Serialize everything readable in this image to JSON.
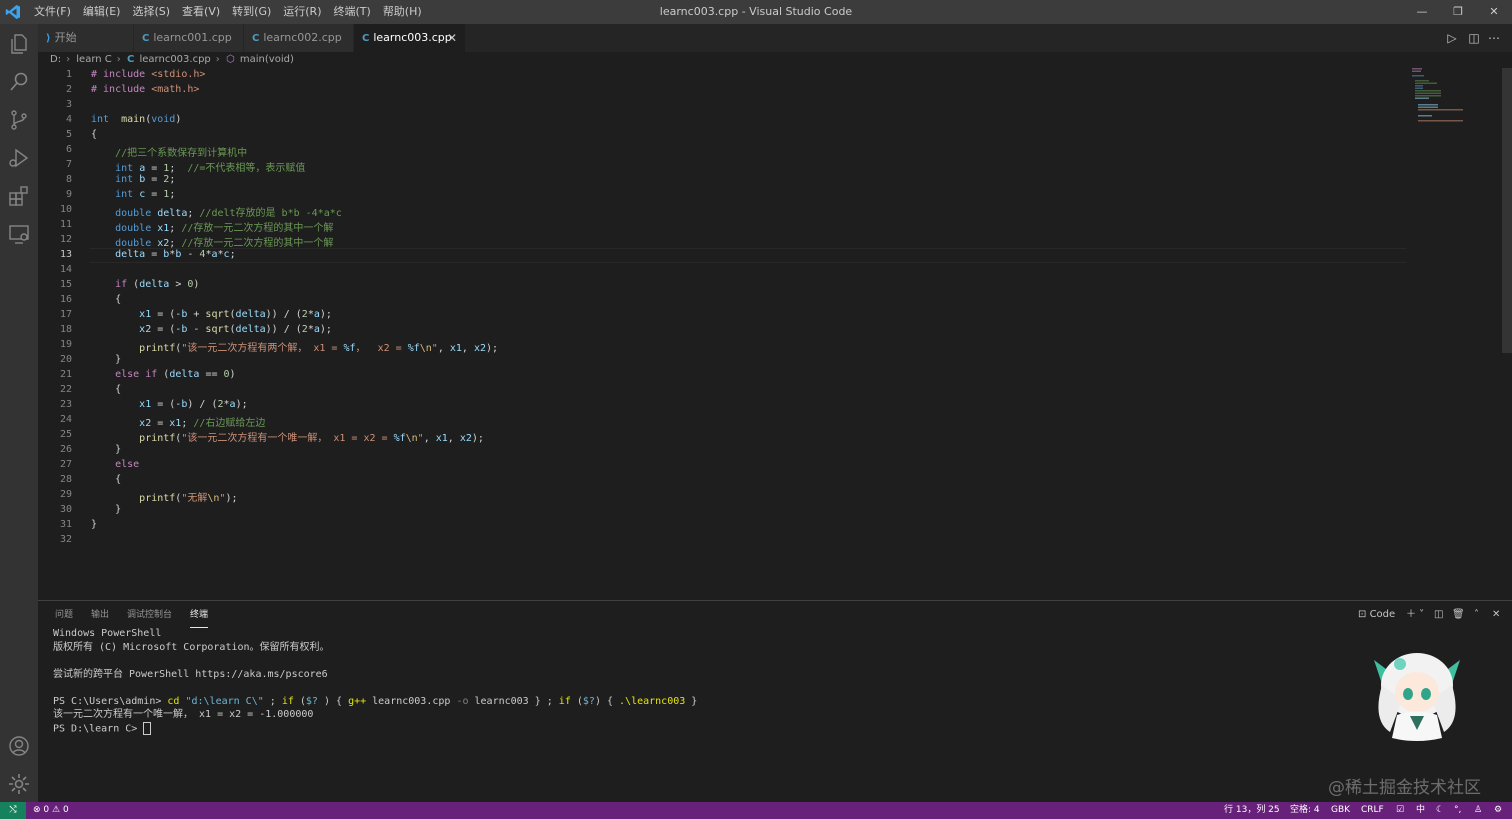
{
  "window": {
    "title": "learnc003.cpp - Visual Studio Code",
    "minimize": "—",
    "restore": "❐",
    "close": "✕"
  },
  "menu": [
    "文件(F)",
    "编辑(E)",
    "选择(S)",
    "查看(V)",
    "转到(G)",
    "运行(R)",
    "终端(T)",
    "帮助(H)"
  ],
  "activity_icons": [
    "files-icon",
    "search-icon",
    "source-control-icon",
    "run-debug-icon",
    "extensions-icon",
    "remote-explorer-icon",
    "account-icon",
    "settings-gear-icon"
  ],
  "tabs": [
    {
      "label": "开始",
      "icon": "vscode-icon",
      "active": false
    },
    {
      "label": "learnc001.cpp",
      "icon": "cpp-file-icon",
      "active": false
    },
    {
      "label": "learnc002.cpp",
      "icon": "cpp-file-icon",
      "active": false
    },
    {
      "label": "learnc003.cpp",
      "icon": "cpp-file-icon",
      "active": true
    }
  ],
  "breadcrumb": {
    "drive": "D:",
    "folder": "learn C",
    "file": "learnc003.cpp",
    "symbol": "main(void)"
  },
  "editor": {
    "current_line": 13,
    "line_numbers": [
      "1",
      "2",
      "3",
      "4",
      "5",
      "6",
      "7",
      "8",
      "9",
      "10",
      "11",
      "12",
      "13",
      "14",
      "15",
      "16",
      "17",
      "18",
      "19",
      "20",
      "21",
      "22",
      "23",
      "24",
      "25",
      "26",
      "27",
      "28",
      "29",
      "30",
      "31",
      "32"
    ],
    "lines": [
      [
        [
          "pp",
          "# include "
        ],
        [
          "str",
          "<stdio.h>"
        ]
      ],
      [
        [
          "pp",
          "# include "
        ],
        [
          "str",
          "<math.h>"
        ]
      ],
      [],
      [
        [
          "kw",
          "int"
        ],
        [
          "",
          "  "
        ],
        [
          "fn",
          "main"
        ],
        [
          "",
          "("
        ],
        [
          "kw",
          "void"
        ],
        [
          "",
          ")"
        ]
      ],
      [
        [
          "",
          "{"
        ]
      ],
      [
        [
          "",
          "    "
        ],
        [
          "cm",
          "//把三个系数保存到计算机中"
        ]
      ],
      [
        [
          "",
          "    "
        ],
        [
          "kw",
          "int"
        ],
        [
          "",
          " "
        ],
        [
          "var",
          "a"
        ],
        [
          "",
          " = "
        ],
        [
          "num",
          "1"
        ],
        [
          "",
          ";  "
        ],
        [
          "cm",
          "//=不代表相等，表示赋值"
        ]
      ],
      [
        [
          "",
          "    "
        ],
        [
          "kw",
          "int"
        ],
        [
          "",
          " "
        ],
        [
          "var",
          "b"
        ],
        [
          "",
          " = "
        ],
        [
          "num",
          "2"
        ],
        [
          "",
          ";"
        ]
      ],
      [
        [
          "",
          "    "
        ],
        [
          "kw",
          "int"
        ],
        [
          "",
          " "
        ],
        [
          "var",
          "c"
        ],
        [
          "",
          " = "
        ],
        [
          "num",
          "1"
        ],
        [
          "",
          ";"
        ]
      ],
      [
        [
          "",
          "    "
        ],
        [
          "kw",
          "double"
        ],
        [
          "",
          " "
        ],
        [
          "var",
          "delta"
        ],
        [
          "",
          "; "
        ],
        [
          "cm",
          "//delt存放的是 b*b -4*a*c"
        ]
      ],
      [
        [
          "",
          "    "
        ],
        [
          "kw",
          "double"
        ],
        [
          "",
          " "
        ],
        [
          "var",
          "x1"
        ],
        [
          "",
          "; "
        ],
        [
          "cm",
          "//存放一元二次方程的其中一个解"
        ]
      ],
      [
        [
          "",
          "    "
        ],
        [
          "kw",
          "double"
        ],
        [
          "",
          " "
        ],
        [
          "var",
          "x2"
        ],
        [
          "",
          "; "
        ],
        [
          "cm",
          "//存放一元二次方程的其中一个解"
        ]
      ],
      [
        [
          "",
          "    "
        ],
        [
          "var",
          "delta"
        ],
        [
          "",
          " = "
        ],
        [
          "var",
          "b"
        ],
        [
          "",
          "*"
        ],
        [
          "var",
          "b"
        ],
        [
          "",
          " - "
        ],
        [
          "num",
          "4"
        ],
        [
          "",
          "*"
        ],
        [
          "var",
          "a"
        ],
        [
          "",
          "*"
        ],
        [
          "var",
          "c"
        ],
        [
          "",
          ";"
        ]
      ],
      [],
      [
        [
          "",
          "    "
        ],
        [
          "pp",
          "if"
        ],
        [
          "",
          " ("
        ],
        [
          "var",
          "delta"
        ],
        [
          "",
          " > "
        ],
        [
          "num",
          "0"
        ],
        [
          "",
          ")"
        ]
      ],
      [
        [
          "",
          "    {"
        ]
      ],
      [
        [
          "",
          "        "
        ],
        [
          "var",
          "x1"
        ],
        [
          "",
          " = (-"
        ],
        [
          "var",
          "b"
        ],
        [
          "",
          " + "
        ],
        [
          "fn",
          "sqrt"
        ],
        [
          "",
          "("
        ],
        [
          "var",
          "delta"
        ],
        [
          "",
          ")) / ("
        ],
        [
          "num",
          "2"
        ],
        [
          "",
          "*"
        ],
        [
          "var",
          "a"
        ],
        [
          "",
          ");"
        ]
      ],
      [
        [
          "",
          "        "
        ],
        [
          "var",
          "x2"
        ],
        [
          "",
          " = (-"
        ],
        [
          "var",
          "b"
        ],
        [
          "",
          " - "
        ],
        [
          "fn",
          "sqrt"
        ],
        [
          "",
          "("
        ],
        [
          "var",
          "delta"
        ],
        [
          "",
          ")) / ("
        ],
        [
          "num",
          "2"
        ],
        [
          "",
          "*"
        ],
        [
          "var",
          "a"
        ],
        [
          "",
          ");"
        ]
      ],
      [
        [
          "",
          "        "
        ],
        [
          "fn",
          "printf"
        ],
        [
          "",
          "("
        ],
        [
          "str",
          "\"该一元二次方程有两个解， x1 = "
        ],
        [
          "var",
          "%f"
        ],
        [
          "str",
          "，  x2 = "
        ],
        [
          "var",
          "%f"
        ],
        [
          "esc",
          "\\n"
        ],
        [
          "str",
          "\""
        ],
        [
          "",
          ", "
        ],
        [
          "var",
          "x1"
        ],
        [
          "",
          ", "
        ],
        [
          "var",
          "x2"
        ],
        [
          "",
          ");"
        ]
      ],
      [
        [
          "",
          "    }"
        ]
      ],
      [
        [
          "",
          "    "
        ],
        [
          "pp",
          "else"
        ],
        [
          "",
          " "
        ],
        [
          "pp",
          "if"
        ],
        [
          "",
          " ("
        ],
        [
          "var",
          "delta"
        ],
        [
          "",
          " == "
        ],
        [
          "num",
          "0"
        ],
        [
          "",
          ")"
        ]
      ],
      [
        [
          "",
          "    {"
        ]
      ],
      [
        [
          "",
          "        "
        ],
        [
          "var",
          "x1"
        ],
        [
          "",
          " = (-"
        ],
        [
          "var",
          "b"
        ],
        [
          "",
          ") / ("
        ],
        [
          "num",
          "2"
        ],
        [
          "",
          "*"
        ],
        [
          "var",
          "a"
        ],
        [
          "",
          ");"
        ]
      ],
      [
        [
          "",
          "        "
        ],
        [
          "var",
          "x2"
        ],
        [
          "",
          " = "
        ],
        [
          "var",
          "x1"
        ],
        [
          "",
          "; "
        ],
        [
          "cm",
          "//右边赋给左边"
        ]
      ],
      [
        [
          "",
          "        "
        ],
        [
          "fn",
          "printf"
        ],
        [
          "",
          "("
        ],
        [
          "str",
          "\"该一元二次方程有一个唯一解， x1 = x2 = "
        ],
        [
          "var",
          "%f"
        ],
        [
          "esc",
          "\\n"
        ],
        [
          "str",
          "\""
        ],
        [
          "",
          ", "
        ],
        [
          "var",
          "x1"
        ],
        [
          "",
          ", "
        ],
        [
          "var",
          "x2"
        ],
        [
          "",
          ");"
        ]
      ],
      [
        [
          "",
          "    }"
        ]
      ],
      [
        [
          "",
          "    "
        ],
        [
          "pp",
          "else"
        ]
      ],
      [
        [
          "",
          "    {"
        ]
      ],
      [
        [
          "",
          "        "
        ],
        [
          "fn",
          "printf"
        ],
        [
          "",
          "("
        ],
        [
          "str",
          "\"无解"
        ],
        [
          "esc",
          "\\n"
        ],
        [
          "str",
          "\""
        ],
        [
          "",
          ");"
        ]
      ],
      [
        [
          "",
          "    }"
        ]
      ],
      [
        [
          "",
          "}"
        ]
      ],
      []
    ]
  },
  "panel": {
    "tabs": [
      "问题",
      "输出",
      "调试控制台",
      "终端"
    ],
    "active_tab": "终端",
    "terminal_name": "Code",
    "terminal_lines": [
      [
        [
          "",
          "Windows PowerShell"
        ]
      ],
      [
        [
          "",
          "版权所有 (C) Microsoft Corporation。保留所有权利。"
        ]
      ],
      [],
      [
        [
          "",
          "尝试新的跨平台 PowerShell https://aka.ms/pscore6"
        ]
      ],
      [],
      [
        [
          "",
          "PS C:\\Users\\admin> "
        ],
        [
          "tyellow",
          "cd"
        ],
        [
          "",
          " "
        ],
        [
          "tcyan",
          "\"d:\\learn C\\\""
        ],
        [
          "",
          " ; "
        ],
        [
          "tyellow",
          "if"
        ],
        [
          "",
          " ("
        ],
        [
          "tcyan",
          "$?"
        ],
        [
          "",
          " ) { "
        ],
        [
          "tyellow",
          "g++"
        ],
        [
          "",
          " learnc003.cpp "
        ],
        [
          "tgray",
          "-o"
        ],
        [
          "",
          " learnc003 } ; "
        ],
        [
          "tyellow",
          "if"
        ],
        [
          "",
          " ("
        ],
        [
          "tcyan",
          "$?"
        ],
        [
          "",
          ") { "
        ],
        [
          "tyellow",
          ".\\learnc003"
        ],
        [
          "",
          " }"
        ]
      ],
      [
        [
          "",
          "该一元二次方程有一个唯一解， x1 = x2 = -1.000000"
        ]
      ],
      [
        [
          "",
          "PS D:\\learn C> "
        ]
      ]
    ]
  },
  "watermark": "@稀土掘金技术社区",
  "status": {
    "errors": "0",
    "warnings": "0",
    "position": "行 13，列 25",
    "spaces": "空格: 4",
    "encoding": "GBK",
    "eol": "CRLF",
    "ime": "中"
  },
  "colors": {
    "statusbar": "#68217a",
    "remote": "#16825d",
    "editor_bg": "#1e1e1e",
    "keyword": "#569cd6",
    "string": "#ce9178",
    "comment": "#6a9955"
  }
}
